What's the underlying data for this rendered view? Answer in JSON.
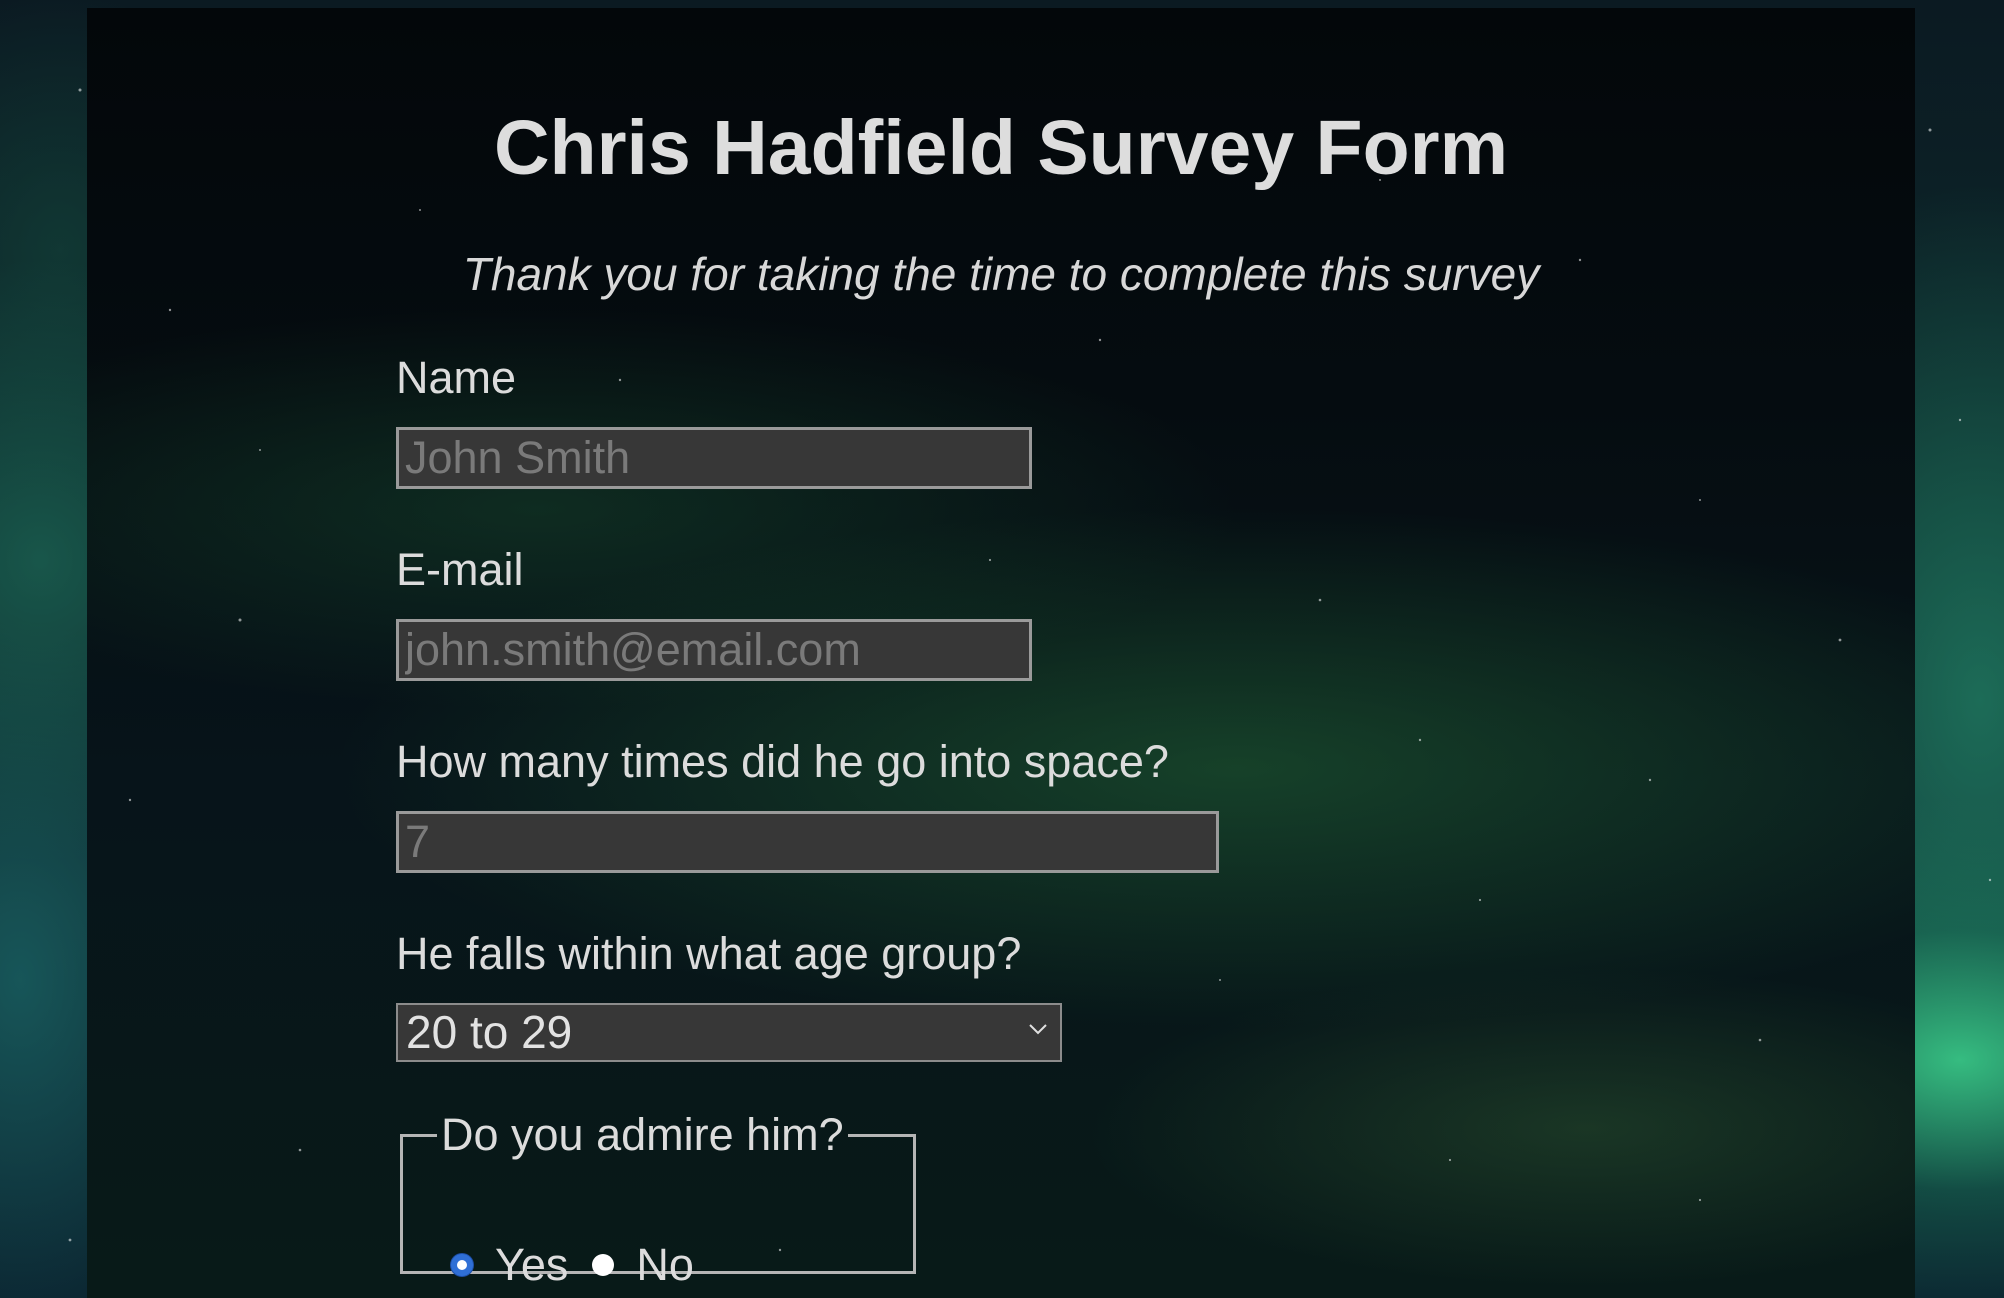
{
  "header": {
    "title": "Chris Hadfield Survey Form",
    "description": "Thank you for taking the time to complete this survey"
  },
  "form": {
    "name": {
      "label": "Name",
      "placeholder": "John Smith"
    },
    "email": {
      "label": "E-mail",
      "placeholder": "john.smith@email.com"
    },
    "space_trips": {
      "label": "How many times did he go into space?",
      "placeholder": "7"
    },
    "age_group": {
      "label": "He falls within what age group?",
      "selected": "20 to 29",
      "icon": "chevron-down-icon"
    },
    "admire": {
      "legend": "Do you admire him?",
      "options": [
        {
          "label": "Yes",
          "checked": true
        },
        {
          "label": "No",
          "checked": false
        }
      ]
    }
  },
  "colors": {
    "panel_background": "#050c10",
    "input_background": "#373737",
    "text": "#dcdcdc",
    "radio_selected": "#2f6fd6",
    "aurora_green": "#3cd28c"
  }
}
